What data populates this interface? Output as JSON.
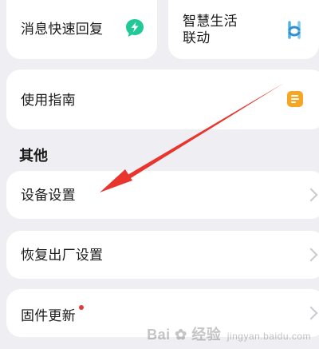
{
  "shortcuts": {
    "quick_reply": {
      "label": "消息快速回复",
      "icon": "lightning-bubble-icon",
      "icon_color": "#20c997"
    },
    "smart_life": {
      "label_line1": "智慧生活",
      "label_line2": "联动",
      "icon": "smart-life-link-icon",
      "icon_color": "#4fb3e8"
    }
  },
  "guide": {
    "label": "使用指南",
    "icon": "document-icon",
    "icon_color": "#f5a623"
  },
  "other_section": {
    "title": "其他",
    "items": [
      {
        "label": "设备设置"
      },
      {
        "label": "恢复出厂设置"
      },
      {
        "label": "固件更新",
        "badge": "red-dot"
      }
    ]
  },
  "annotation": {
    "type": "red-arrow",
    "color": "#e8362f",
    "points_to": "设备设置"
  },
  "watermark": {
    "text": "Bai",
    "text2": "经验",
    "sub": "jingyan.baidu.com"
  }
}
